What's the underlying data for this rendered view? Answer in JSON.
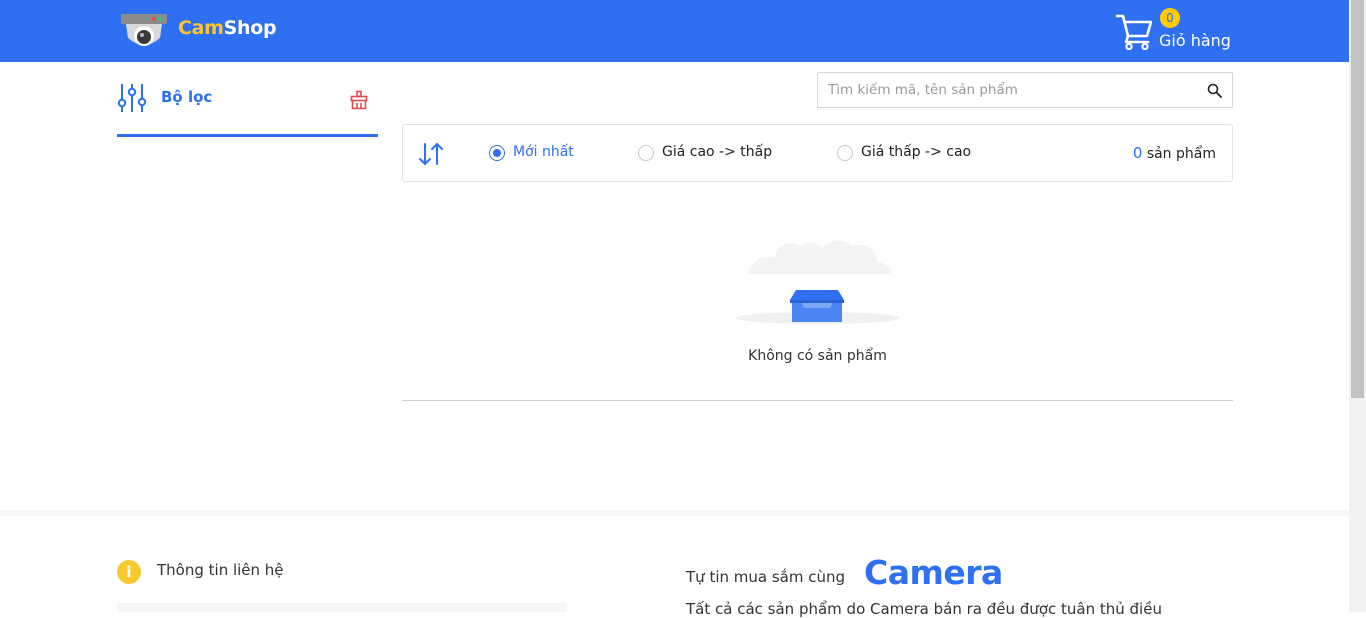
{
  "header": {
    "brand_part1": "Cam",
    "brand_part2": "Shop",
    "cart_count": "0",
    "cart_label": "Giỏ hàng"
  },
  "filter": {
    "title": "Bộ lọc"
  },
  "search": {
    "placeholder": "Tìm kiếm mã, tên sản phẩm",
    "value": ""
  },
  "sort": {
    "options": [
      {
        "label": "Mới nhất",
        "selected": true
      },
      {
        "label": "Giá cao -> thấp",
        "selected": false
      },
      {
        "label": "Giá thấp -> cao",
        "selected": false
      }
    ],
    "count_number": "0",
    "count_label": "sản phẩm"
  },
  "empty": {
    "message": "Không có sản phẩm"
  },
  "footer": {
    "contact_title": "Thông tin liên hệ",
    "info_icon_glyph": "i",
    "confident_text": "Tự tin mua sắm cùng",
    "confident_brand": "Camera",
    "confident_desc": "Tất cả các sản phẩm do Camera bán ra đều được tuân thủ điều"
  },
  "colors": {
    "primary": "#2f6ff1",
    "brand_yellow": "#ffc530",
    "badge": "#ffcc00",
    "clear_icon": "#e24b4b"
  }
}
